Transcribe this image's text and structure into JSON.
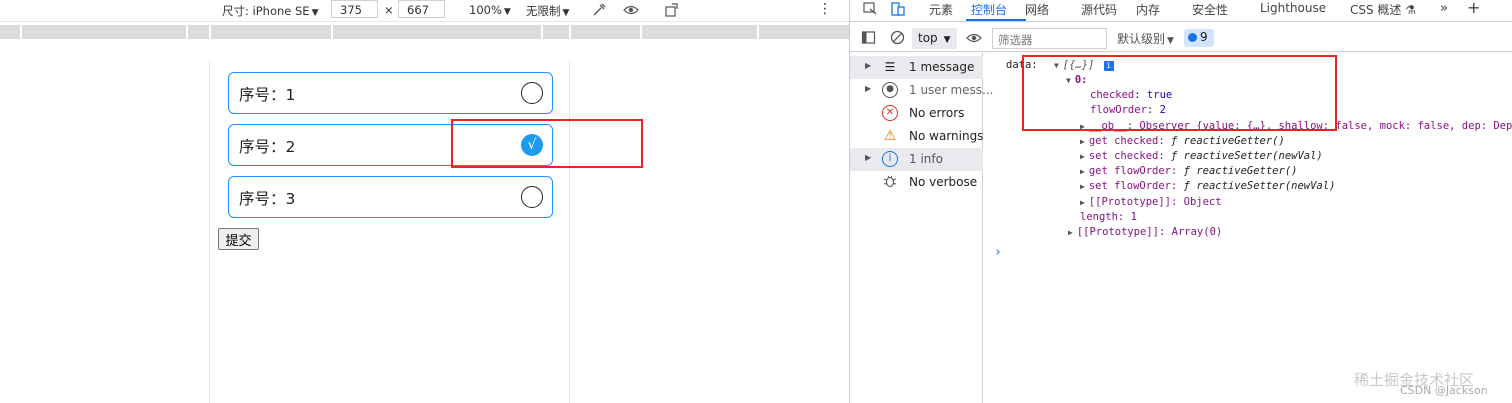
{
  "device_toolbar": {
    "size_label": "尺寸: iPhone SE",
    "width": "375",
    "times": "×",
    "height": "667",
    "zoom": "100%",
    "throttle": "无限制",
    "more": "⋮"
  },
  "app": {
    "items": [
      {
        "label": "序号：1",
        "checked": false
      },
      {
        "label": "序号：2",
        "checked": true,
        "check_mark": "√"
      },
      {
        "label": "序号：3",
        "checked": false
      }
    ],
    "submit_label": "提交"
  },
  "devtools": {
    "tabs": [
      "元素",
      "控制台",
      "网络",
      "源代码",
      "内存",
      "安全性",
      "Lighthouse",
      "CSS 概述 ⚗"
    ],
    "active_tab": "控制台",
    "context": "top",
    "filter_placeholder": "筛选器",
    "levels": "默认级别",
    "issues_count": "9",
    "sidebar": [
      {
        "label": "1 message",
        "icon": "list-icon",
        "expandable": true
      },
      {
        "label": "1 user mess...",
        "icon": "user-icon",
        "expandable": true
      },
      {
        "label": "No errors",
        "icon": "error-icon",
        "expandable": false
      },
      {
        "label": "No warnings",
        "icon": "warning-icon",
        "expandable": false
      },
      {
        "label": "1 info",
        "icon": "info-icon",
        "expandable": true
      },
      {
        "label": "No verbose",
        "icon": "bug-icon",
        "expandable": false
      }
    ],
    "console": {
      "data_key": "data:",
      "data_summary": "[{…}]",
      "index_key": "0:",
      "checked_key": "checked",
      "checked_val": "true",
      "flow_key": "flowOrder",
      "flow_val": "2",
      "ob_line": "__ob__: Observer {value: {…}, shallow: false, mock: false, dep: Dep",
      "get_checked": "get checked:",
      "set_checked": "set checked:",
      "get_flow": "get flowOrder:",
      "set_flow": "set flowOrder:",
      "f": "ƒ",
      "reactive_getter": "reactiveGetter()",
      "reactive_setter": "reactiveSetter(newVal)",
      "proto_obj": "[[Prototype]]: Object",
      "length": "length: 1",
      "proto_arr": "[[Prototype]]: Array(0)"
    }
  },
  "watermark": "稀土掘金技术社区",
  "watermark2": "CSDN @Jackson"
}
